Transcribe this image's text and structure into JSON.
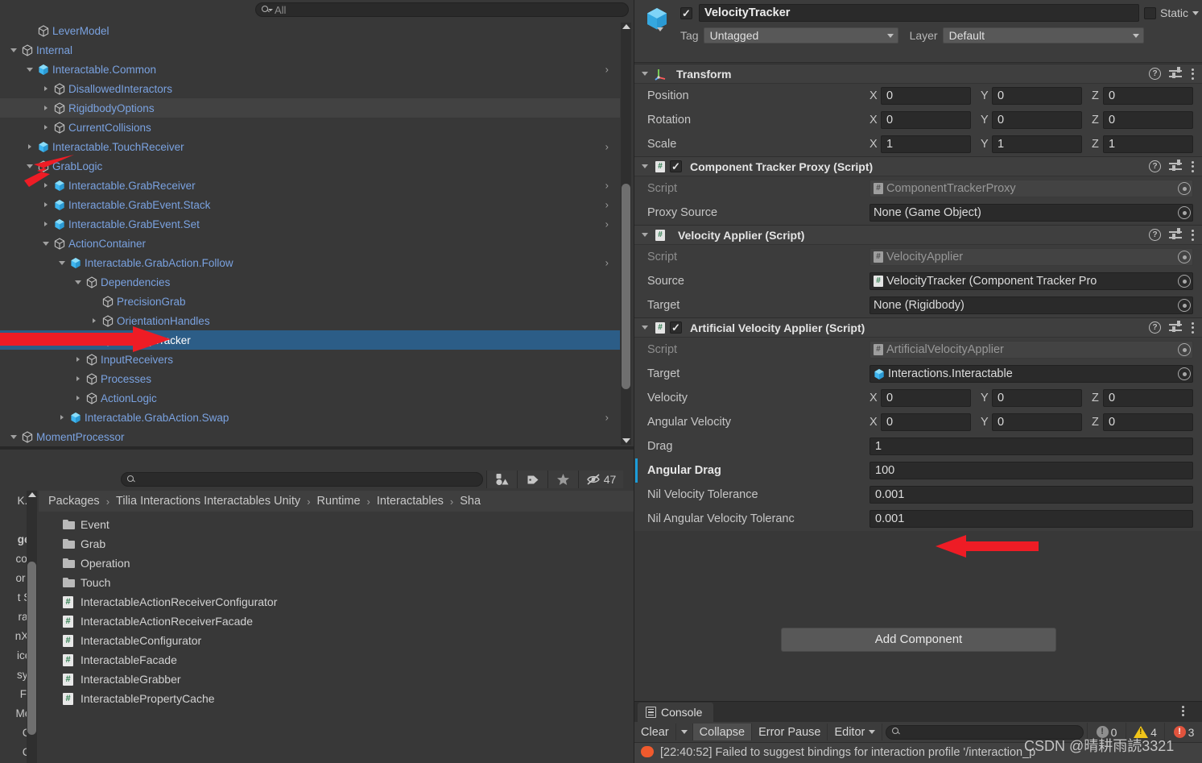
{
  "hierarchy": {
    "search": {
      "placeholder": "All",
      "icon": "search-icon"
    },
    "rows": [
      {
        "label": "LeverModel",
        "depth": 2,
        "arrow": "none",
        "icon": "gameobject-cube",
        "chevron": false,
        "alt": false,
        "selected": false
      },
      {
        "label": "Internal",
        "depth": 1,
        "arrow": "expanded",
        "icon": "gameobject-cube",
        "chevron": false,
        "alt": false,
        "selected": false
      },
      {
        "label": "Interactable.Common",
        "depth": 2,
        "arrow": "expanded",
        "icon": "prefab-cube",
        "chevron": true,
        "alt": false,
        "selected": false
      },
      {
        "label": "DisallowedInteractors",
        "depth": 3,
        "arrow": "collapsed",
        "icon": "gameobject-cube",
        "chevron": false,
        "alt": false,
        "selected": false
      },
      {
        "label": "RigidbodyOptions",
        "depth": 3,
        "arrow": "collapsed",
        "icon": "gameobject-cube",
        "chevron": false,
        "alt": true,
        "selected": false
      },
      {
        "label": "CurrentCollisions",
        "depth": 3,
        "arrow": "collapsed",
        "icon": "gameobject-cube",
        "chevron": false,
        "alt": false,
        "selected": false
      },
      {
        "label": "Interactable.TouchReceiver",
        "depth": 2,
        "arrow": "collapsed",
        "icon": "prefab-cube",
        "chevron": true,
        "alt": false,
        "selected": false
      },
      {
        "label": "GrabLogic",
        "depth": 2,
        "arrow": "expanded",
        "icon": "gameobject-cube",
        "chevron": false,
        "alt": false,
        "selected": false
      },
      {
        "label": "Interactable.GrabReceiver",
        "depth": 3,
        "arrow": "collapsed",
        "icon": "prefab-cube",
        "chevron": true,
        "alt": false,
        "selected": false
      },
      {
        "label": "Interactable.GrabEvent.Stack",
        "depth": 3,
        "arrow": "collapsed",
        "icon": "prefab-cube",
        "chevron": true,
        "alt": false,
        "selected": false
      },
      {
        "label": "Interactable.GrabEvent.Set",
        "depth": 3,
        "arrow": "collapsed",
        "icon": "prefab-cube",
        "chevron": true,
        "alt": false,
        "selected": false
      },
      {
        "label": "ActionContainer",
        "depth": 3,
        "arrow": "expanded",
        "icon": "gameobject-cube",
        "chevron": false,
        "alt": false,
        "selected": false
      },
      {
        "label": "Interactable.GrabAction.Follow",
        "depth": 4,
        "arrow": "expanded",
        "icon": "prefab-cube",
        "chevron": true,
        "alt": false,
        "selected": false
      },
      {
        "label": "Dependencies",
        "depth": 5,
        "arrow": "expanded",
        "icon": "gameobject-cube",
        "chevron": false,
        "alt": false,
        "selected": false
      },
      {
        "label": "PrecisionGrab",
        "depth": 6,
        "arrow": "none",
        "icon": "gameobject-cube",
        "chevron": false,
        "alt": false,
        "selected": false
      },
      {
        "label": "OrientationHandles",
        "depth": 6,
        "arrow": "collapsed",
        "icon": "gameobject-cube",
        "chevron": false,
        "alt": false,
        "selected": false
      },
      {
        "label": "VelocityTracker",
        "depth": 6,
        "arrow": "none",
        "icon": "gameobject-cube",
        "chevron": false,
        "alt": false,
        "selected": true
      },
      {
        "label": "InputReceivers",
        "depth": 5,
        "arrow": "collapsed",
        "icon": "gameobject-cube",
        "chevron": false,
        "alt": false,
        "selected": false
      },
      {
        "label": "Processes",
        "depth": 5,
        "arrow": "collapsed",
        "icon": "gameobject-cube",
        "chevron": false,
        "alt": false,
        "selected": false
      },
      {
        "label": "ActionLogic",
        "depth": 5,
        "arrow": "collapsed",
        "icon": "gameobject-cube",
        "chevron": false,
        "alt": false,
        "selected": false
      },
      {
        "label": "Interactable.GrabAction.Swap",
        "depth": 4,
        "arrow": "collapsed",
        "icon": "prefab-cube",
        "chevron": true,
        "alt": false,
        "selected": false
      },
      {
        "label": "MomentProcessor",
        "depth": 1,
        "arrow": "expanded",
        "icon": "gameobject-cube",
        "chevron": false,
        "alt": false,
        "selected": false
      }
    ],
    "footer": {
      "lock_icon": "lock-icon",
      "menu_icon": "kebab-menu-icon"
    }
  },
  "project": {
    "search": {
      "placeholder": "",
      "icon": "search-icon"
    },
    "toolbar_buttons": [
      {
        "name": "filter-by-type-icon",
        "label": ""
      },
      {
        "name": "filter-by-label-icon",
        "label": ""
      },
      {
        "name": "favorites-star-icon",
        "label": ""
      }
    ],
    "hidden_count": "47",
    "hidden_count_icon": "eye-off-icon",
    "breadcrumb": [
      "Packages",
      "Tilia Interactions Interactables Unity",
      "Runtime",
      "Interactables",
      "Sha"
    ],
    "left_tree_fragments": [
      "K.Ti",
      "",
      "ges",
      "com",
      "or C",
      "t Sy",
      "rain",
      "nXR",
      "ices",
      "syst",
      "Fra",
      "Mes",
      "Ca",
      "Ca"
    ],
    "items": [
      {
        "label": "Event",
        "icon": "folder-icon"
      },
      {
        "label": "Grab",
        "icon": "folder-icon"
      },
      {
        "label": "Operation",
        "icon": "folder-icon"
      },
      {
        "label": "Touch",
        "icon": "folder-icon"
      },
      {
        "label": "InteractableActionReceiverConfigurator",
        "icon": "script-icon"
      },
      {
        "label": "InteractableActionReceiverFacade",
        "icon": "script-icon"
      },
      {
        "label": "InteractableConfigurator",
        "icon": "script-icon"
      },
      {
        "label": "InteractableFacade",
        "icon": "script-icon"
      },
      {
        "label": "InteractableGrabber",
        "icon": "script-icon"
      },
      {
        "label": "InteractablePropertyCache",
        "icon": "script-icon"
      }
    ]
  },
  "inspector": {
    "enabled": true,
    "name": "VelocityTracker",
    "static_label": "Static",
    "static_checked": false,
    "tag_label": "Tag",
    "tag_value": "Untagged",
    "layer_label": "Layer",
    "layer_value": "Default",
    "transform": {
      "title": "Transform",
      "rows": [
        {
          "label": "Position",
          "x": "0",
          "y": "0",
          "z": "0"
        },
        {
          "label": "Rotation",
          "x": "0",
          "y": "0",
          "z": "0"
        },
        {
          "label": "Scale",
          "x": "1",
          "y": "1",
          "z": "1"
        }
      ]
    },
    "components": [
      {
        "title": "Component Tracker Proxy (Script)",
        "has_checkbox": true,
        "checked": true,
        "fields": [
          {
            "label": "Script",
            "type": "object",
            "value": "ComponentTrackerProxy",
            "icon": "script-icon",
            "dim": true
          },
          {
            "label": "Proxy Source",
            "type": "object",
            "value": "None (Game Object)",
            "icon": "none",
            "dim": false
          }
        ]
      },
      {
        "title": "Velocity Applier (Script)",
        "has_checkbox": false,
        "checked": false,
        "fields": [
          {
            "label": "Script",
            "type": "object",
            "value": "VelocityApplier",
            "icon": "script-icon",
            "dim": true
          },
          {
            "label": "Source",
            "type": "object",
            "value": "VelocityTracker (Component Tracker Pro",
            "icon": "script-icon",
            "dim": false
          },
          {
            "label": "Target",
            "type": "object",
            "value": "None (Rigidbody)",
            "icon": "none",
            "dim": false
          }
        ]
      },
      {
        "title": "Artificial Velocity Applier (Script)",
        "has_checkbox": true,
        "checked": true,
        "fields": [
          {
            "label": "Script",
            "type": "object",
            "value": "ArtificialVelocityApplier",
            "icon": "script-icon",
            "dim": true
          },
          {
            "label": "Target",
            "type": "object",
            "value": "Interactions.Interactable",
            "icon": "prefab-cube",
            "dim": false
          },
          {
            "label": "Velocity",
            "type": "vector3",
            "x": "0",
            "y": "0",
            "z": "0"
          },
          {
            "label": "Angular Velocity",
            "type": "vector3",
            "x": "0",
            "y": "0",
            "z": "0"
          },
          {
            "label": "Drag",
            "type": "number",
            "value": "1"
          },
          {
            "label": "Angular Drag",
            "type": "number",
            "value": "100",
            "override": true,
            "bold": true
          },
          {
            "label": "Nil Velocity Tolerance",
            "type": "number",
            "value": "0.001"
          },
          {
            "label": "Nil Angular Velocity Toleranc",
            "type": "number",
            "value": "0.001"
          }
        ]
      }
    ],
    "add_component_label": "Add Component"
  },
  "console": {
    "tab_label": "Console",
    "buttons": {
      "clear": "Clear",
      "collapse": "Collapse",
      "error_pause": "Error Pause",
      "editor": "Editor"
    },
    "search_placeholder": "",
    "counts": {
      "info": "0",
      "warning": "4",
      "error": "3"
    },
    "message": "[22:40:52] Failed to suggest bindings for interaction profile '/interaction_p"
  },
  "watermark": "CSDN @晴耕雨読3321",
  "colors": {
    "selection_blue": "#2c5d87",
    "hierarchy_text_blue": "#7aa2e0",
    "override_marker": "#1b9cd8",
    "annotation_red": "#ee1c25",
    "panel_bg": "#383838",
    "field_bg": "#2a2a2a",
    "error_red": "#e0533d",
    "warning_yellow": "#f0c419"
  }
}
